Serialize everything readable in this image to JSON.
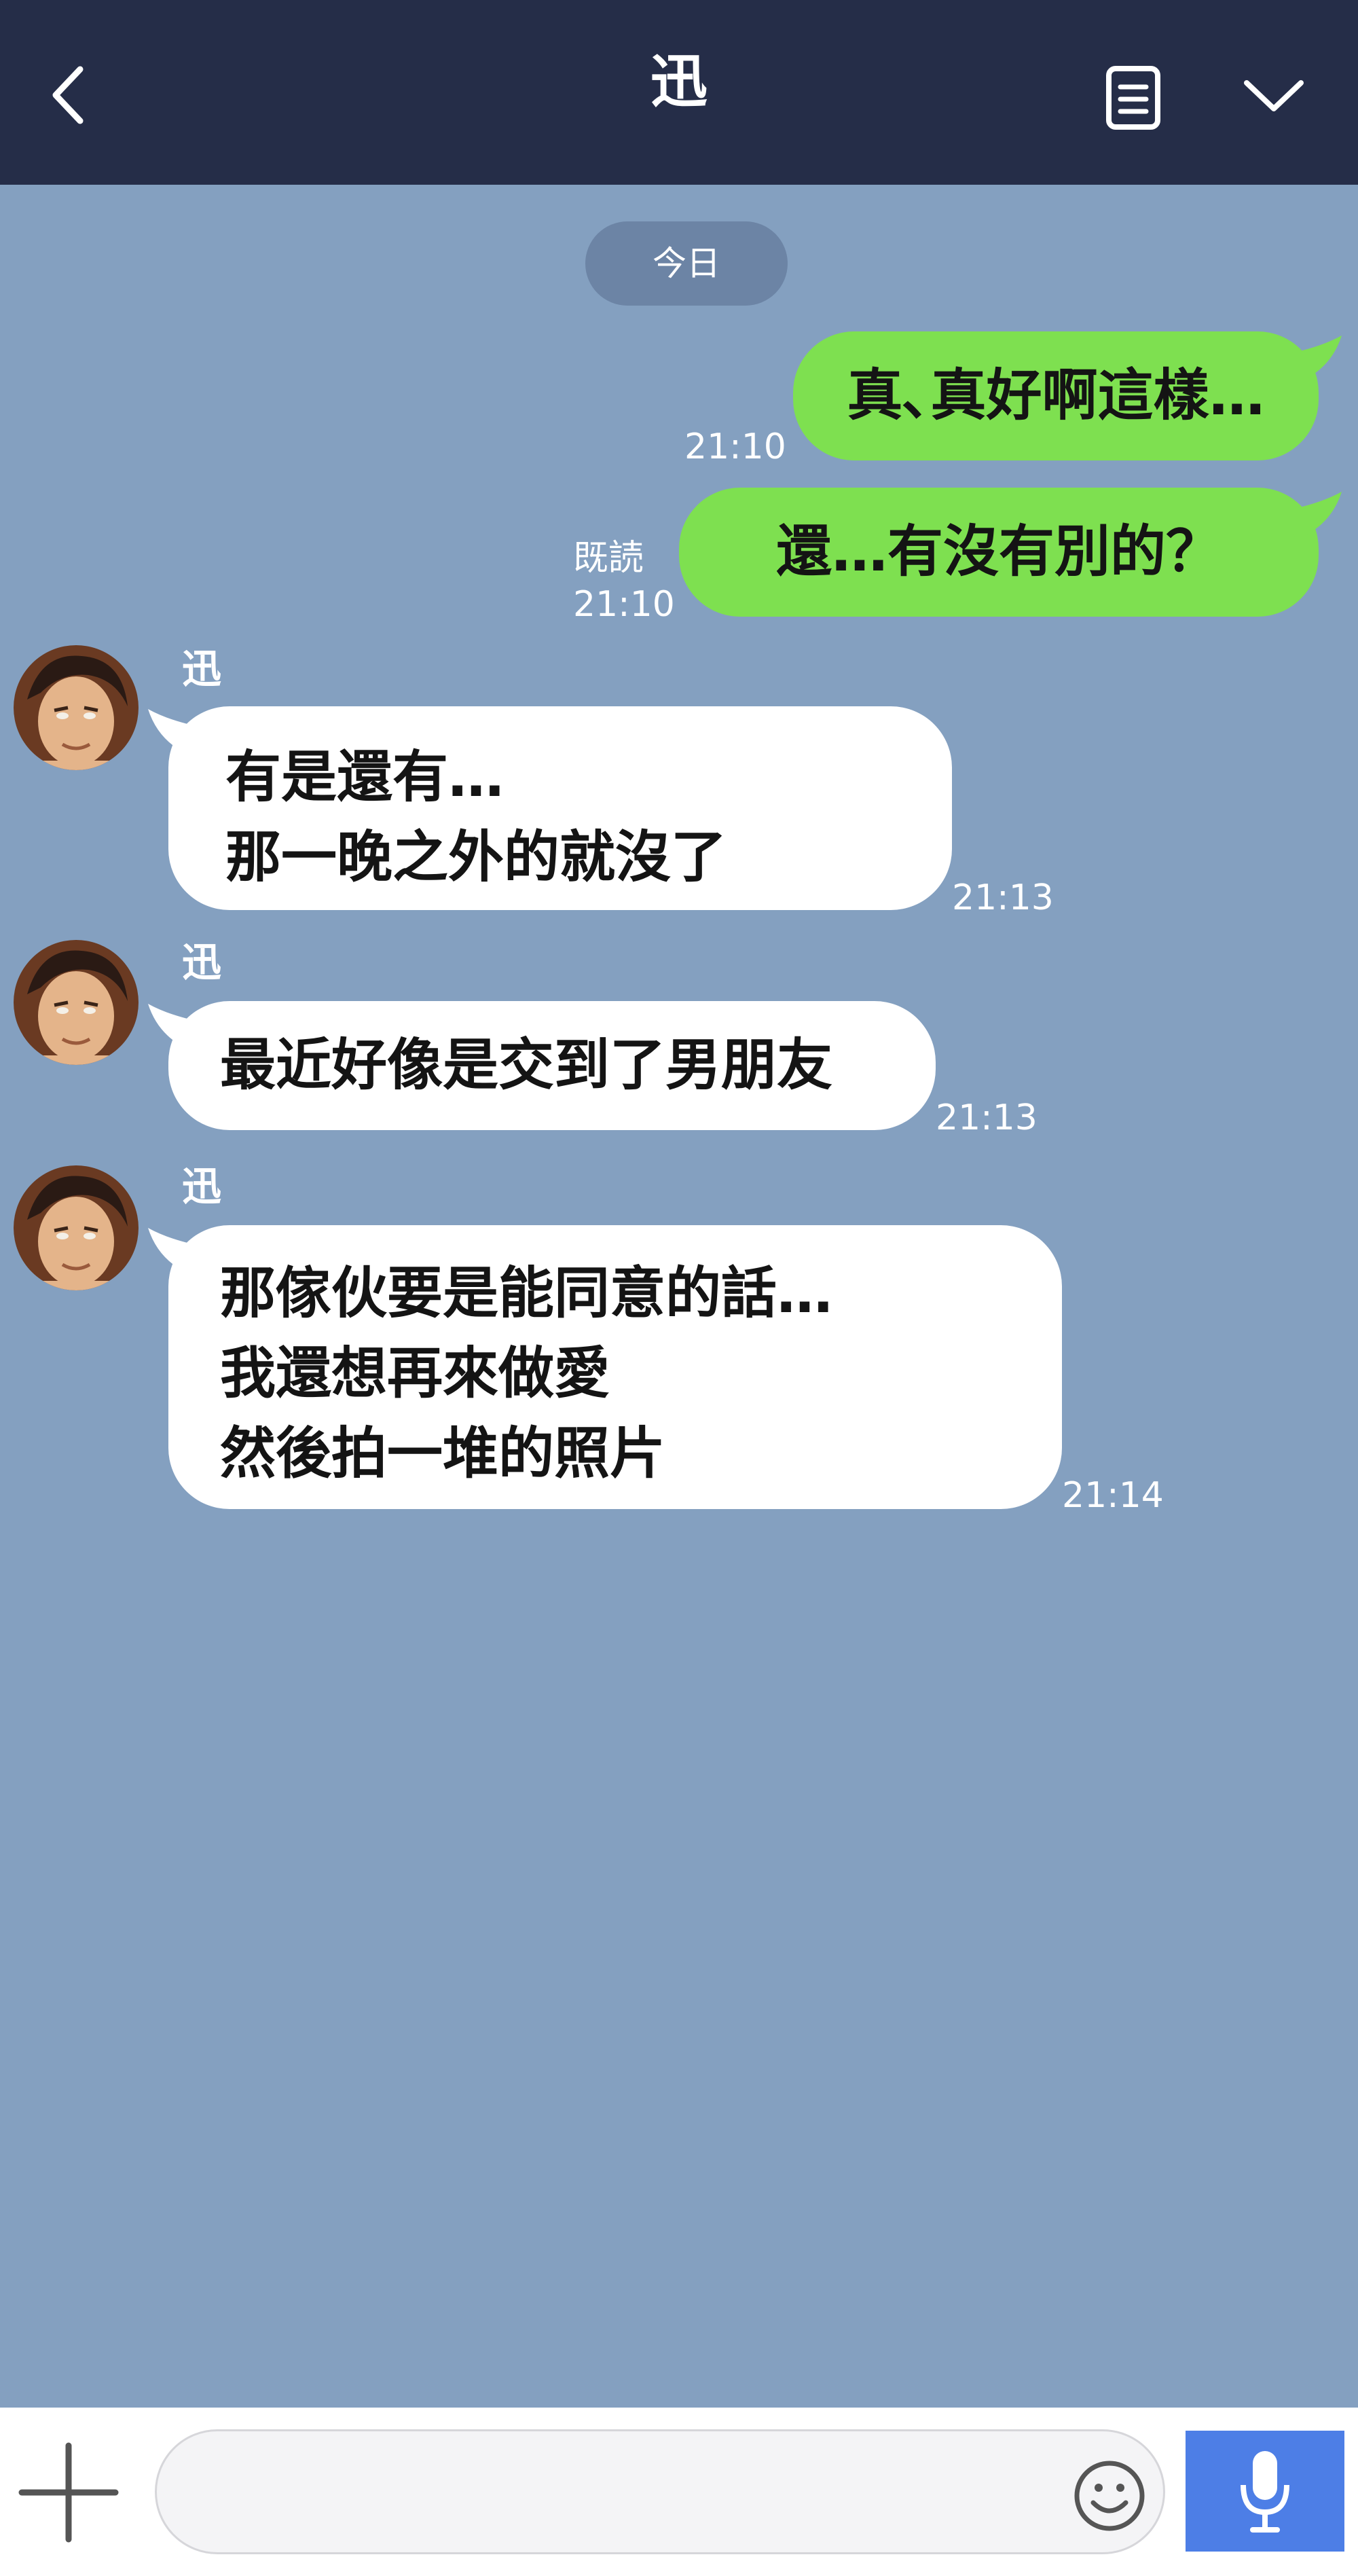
{
  "header": {
    "title": "迅"
  },
  "date_divider": "今日",
  "messages": [
    {
      "from": "me",
      "text": "真､真好啊這樣…",
      "time": "21:10"
    },
    {
      "from": "me",
      "text": "還…有沒有別的？",
      "time": "21:10",
      "read_label": "既読"
    },
    {
      "from": "迅",
      "sender": "迅",
      "lines": [
        "有是還有…",
        "那一晚之外的就沒了"
      ],
      "time": "21:13"
    },
    {
      "from": "迅",
      "sender": "迅",
      "lines": [
        "最近好像是交到了男朋友"
      ],
      "time": "21:13"
    },
    {
      "from": "迅",
      "sender": "迅",
      "lines": [
        "那傢伙要是能同意的話…",
        "我還想再來做愛",
        "然後拍一堆的照片"
      ],
      "time": "21:14"
    }
  ],
  "input": {
    "value": "",
    "placeholder": ""
  },
  "colors": {
    "header_bg": "#252d48",
    "chat_bg": "#84a0c0",
    "my_bubble": "#7ee050",
    "their_bubble": "#ffffff",
    "mic_button": "#4d7ee6"
  },
  "icons": [
    "back-chevron-icon",
    "notes-icon",
    "chevron-down-icon",
    "plus-icon",
    "emoji-icon",
    "microphone-icon"
  ]
}
